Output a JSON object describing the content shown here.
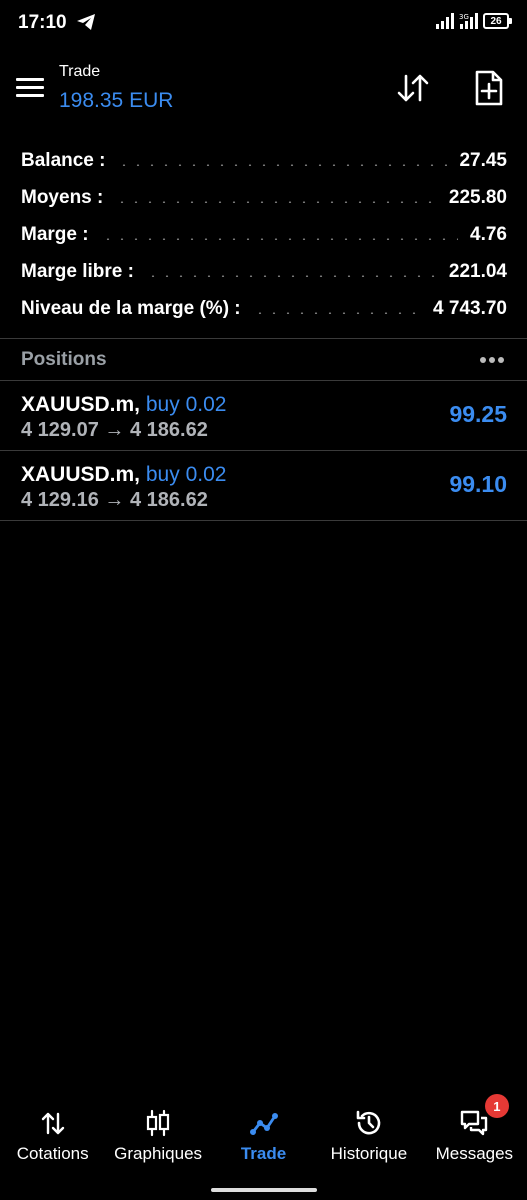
{
  "status_bar": {
    "time": "17:10",
    "network": "3G",
    "battery": "26"
  },
  "header": {
    "title": "Trade",
    "balance": "198.35 EUR"
  },
  "summary": [
    {
      "label": "Balance :",
      "value": "27.45"
    },
    {
      "label": "Moyens :",
      "value": "225.80"
    },
    {
      "label": "Marge :",
      "value": "4.76"
    },
    {
      "label": "Marge libre :",
      "value": "221.04"
    },
    {
      "label": "Niveau de la marge (%) :",
      "value": "4 743.70"
    }
  ],
  "positions": {
    "title": "Positions",
    "items": [
      {
        "symbol": "XAUUSD.m,",
        "type": "buy 0.02",
        "prices": "4 129.07 → 4 186.62",
        "profit": "99.25"
      },
      {
        "symbol": "XAUUSD.m,",
        "type": "buy 0.02",
        "prices": "4 129.16 → 4 186.62",
        "profit": "99.10"
      }
    ]
  },
  "nav": {
    "items": [
      {
        "label": "Cotations",
        "icon": "quotes-icon"
      },
      {
        "label": "Graphiques",
        "icon": "candles-icon"
      },
      {
        "label": "Trade",
        "icon": "trade-icon",
        "active": true
      },
      {
        "label": "Historique",
        "icon": "history-icon"
      },
      {
        "label": "Messages",
        "icon": "messages-icon",
        "badge": "1"
      }
    ]
  },
  "colors": {
    "accent": "#3b8cf0",
    "badge": "#e53935",
    "background": "#000000"
  }
}
